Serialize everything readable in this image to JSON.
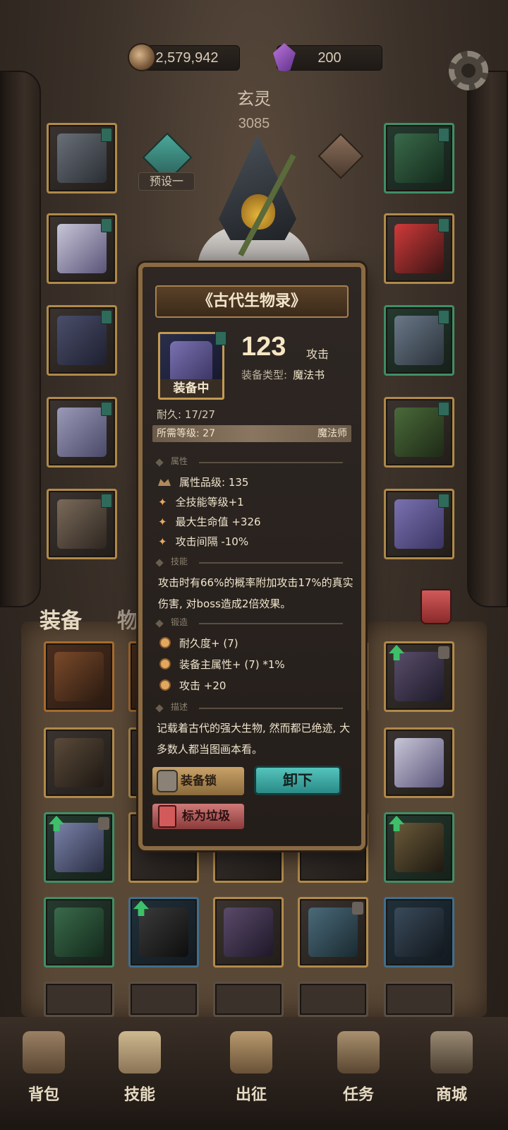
{
  "currencies": {
    "coins": "2,579,942",
    "gems": "200"
  },
  "character": {
    "name": "玄灵",
    "power": "3085",
    "preset_label": "预设一"
  },
  "inventory_tabs": {
    "equipment": "装备",
    "items": "物品"
  },
  "item_tooltip": {
    "title": "《古代生物录》",
    "equipped_label": "装备中",
    "attack_value": "123",
    "attack_label": "攻击",
    "type_label": "装备类型:",
    "type_value": "魔法书",
    "durability": "耐久: 17/27",
    "required_level": "所需等级: 27",
    "required_class": "魔法师",
    "section_attributes": "属性",
    "attribute_quality": "属性品级: 135",
    "attributes": [
      "全技能等级+1",
      "最大生命值 +326",
      "攻击间隔 -10%"
    ],
    "section_skill": "技能",
    "skill_text": "攻击时有66%的概率附加攻击17%的真实伤害, 对boss造成2倍效果。",
    "section_forge": "锻造",
    "forge": [
      "耐久度+ (7)",
      "装备主属性+ (7) *1%",
      "攻击 +20"
    ],
    "section_desc": "描述",
    "description": "记载着古代的强大生物, 然而都已绝迹, 大多数人都当图画本看。",
    "btn_lock": "装备锁",
    "btn_unequip": "卸下",
    "btn_junk": "标为垃圾"
  },
  "bottom_nav": [
    {
      "label": "背包"
    },
    {
      "label": "技能"
    },
    {
      "label": "出征"
    },
    {
      "label": "任务"
    },
    {
      "label": "商城"
    }
  ],
  "colors": {
    "accent_gold": "#c49a52",
    "unequip_button": "#55c4bc",
    "junk_button": "#d07a78",
    "lock_button": "#c9a268"
  }
}
